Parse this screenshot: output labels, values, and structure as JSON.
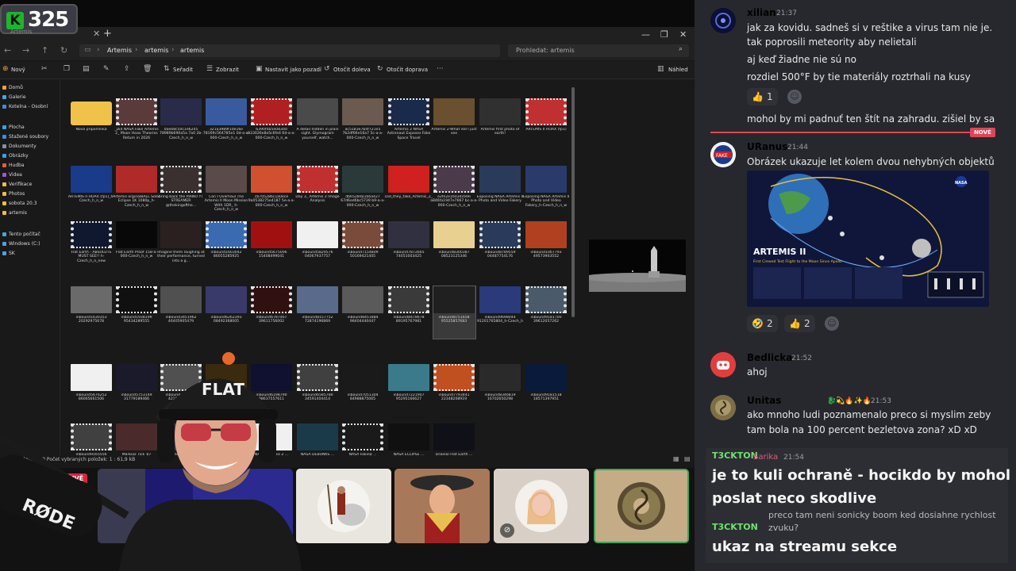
{
  "overlay_counter": {
    "k_label": "K",
    "value": "325"
  },
  "explorer": {
    "window_title": "Artemis",
    "breadcrumbs": [
      "Artemis",
      "artemis",
      "artemis"
    ],
    "search_placeholder": "Prohledat: artemis",
    "toolbar": {
      "new_label": "Nový",
      "sort_label": "Seřadit",
      "view_label": "Zobrazit",
      "set_bg_label": "Nastavit jako pozadí",
      "rotate_left_label": "Otočit doleva",
      "rotate_right_label": "Otočit doprava",
      "details_label": "Náhled"
    },
    "nav_items": [
      {
        "label": "Domů",
        "color": "#e8a33c"
      },
      {
        "label": "Galerie",
        "color": "#4aa3e0"
      },
      {
        "label": "Kotelna - Osobní",
        "color": "#3d8be0"
      },
      {
        "label": "Plocha",
        "color": "#3da0e0"
      },
      {
        "label": "Stažené soubory",
        "color": "#3d8be0"
      },
      {
        "label": "Dokumenty",
        "color": "#8a8fa0"
      },
      {
        "label": "Obrázky",
        "color": "#3da0e0"
      },
      {
        "label": "Hudba",
        "color": "#e0603d"
      },
      {
        "label": "Videa",
        "color": "#9b59d0"
      },
      {
        "label": "Verifikace",
        "color": "#e8c13c"
      },
      {
        "label": "Photos",
        "color": "#e8c13c"
      },
      {
        "label": "sobota 20.3",
        "color": "#e8c13c"
      },
      {
        "label": "artemis",
        "color": "#e8c13c"
      },
      {
        "label": "Tento počítač",
        "color": "#4aa3e0"
      },
      {
        "label": "Windows (C:)",
        "color": "#4aa3e0"
      },
      {
        "label": "SK",
        "color": "#4aa3e0"
      }
    ],
    "files": [
      {
        "name": "Nová připomínka",
        "color": "#f0c24a",
        "folder": true
      },
      {
        "name": "_Did NASA Fake Artemis 2_ Moon Hoax Theories Return in 2026",
        "color": "#5a3a3a"
      },
      {
        "name": "0ae68c50c1e6245 78989b690a5a 7a0 2b-Czech_h_n_w",
        "color": "#2a2a4a"
      },
      {
        "name": "321a3989f10e16e 78169c564785e1 0d-a-a-000-Czech_h_n_w",
        "color": "#3a5aa0"
      },
      {
        "name": "6390f4b5e083dd 833026e8a5c6fe4 6d-a-a-000-Czech_h_n_w",
        "color": "#b02020"
      },
      {
        "name": "A detail hidden in plain sight. Glymogram yourself, watch...",
        "color": "#4a4a4a"
      },
      {
        "name": "ac5183e7b4f721e5 7b2df66e16a7 5c-a-a-000-Czech_h_n_w",
        "color": "#6a5a50"
      },
      {
        "name": "Artemis 2 NASA Astronaut Exposes Fake Space Travel",
        "color": "#1a2a4a"
      },
      {
        "name": "Artemis 2-What did I just see",
        "color": "#6a5030"
      },
      {
        "name": "Artemis first photo of earth!",
        "color": "#303030"
      },
      {
        "name": "ARTEMIS II HOAX (fp1)",
        "color": "#c03030"
      },
      {
        "name": "ARTEMIS II HOAX (fp1)_h-Czech_h_n_w",
        "color": "#1a3a8a"
      },
      {
        "name": "Artemis orginalBALL Solar Eclipse 1K 1080p_h-Czech_h_n_w",
        "color": "#b02a2a"
      },
      {
        "name": "bring back the PIANO YT STREAMER @thekingofthe...",
        "color": "#3a3030"
      },
      {
        "name": "Can I Overhaul The Artemis II Moon Mission With 1DR_ h-Czech_h_n_w",
        "color": "#5a4a4a"
      },
      {
        "name": "cb705286c1a0ece 9a0538275e4187 5e-a-a-000-Czech_h_n_w",
        "color": "#d05030"
      },
      {
        "name": "Day 3_ Artemis 2 Image Analysis",
        "color": "#c03030"
      },
      {
        "name": "db6528da166a427 67d6ed6bc5739 b9-a-a-000-Czech_h_n_w",
        "color": "#2a3a3a"
      },
      {
        "name": "Did_they_fake_Artemis_2_",
        "color": "#d02020"
      },
      {
        "name": "e2fe2e16034c666 a846fa1947e7667 bc-a-a-000-Czech_h_n_w",
        "color": "#4a3a4a"
      },
      {
        "name": "Exposing NASA Artemis II Photo and Video Fakery",
        "color": "#2a3a5a"
      },
      {
        "name": "Exposing NASA Artemis II Photo and Video Fakery_h-Czech_h_n_w",
        "color": "#2a3a6a"
      },
      {
        "name": "Flat Earth - ABSOLUTE MUST SEE!! h-Czech_h_n_new",
        "color": "#101830"
      },
      {
        "name": "Flat Earth Proof 158-a-000-Czech_h_n_w",
        "color": "#080808"
      },
      {
        "name": "Imagine them laughing at their performance, turned into a g...",
        "color": "#2a2020"
      },
      {
        "name": "inbound1603042 86055285925",
        "color": "#3a6ab0"
      },
      {
        "name": "inbound5675006 15408499041",
        "color": "#a01010"
      },
      {
        "name": "inbound5829576 04067937757",
        "color": "#f0f0f0"
      },
      {
        "name": "inbound7154809 50169421405",
        "color": "#7a4a3a"
      },
      {
        "name": "inbound7872665 74051003425",
        "color": "#303040"
      },
      {
        "name": "inbound8300387 08523125346",
        "color": "#e8d090"
      },
      {
        "name": "inbound8789559 04487754176",
        "color": "#2a3a5a"
      },
      {
        "name": "inbound1067793 49573903552",
        "color": "#b04020"
      },
      {
        "name": "inbound1630353 20292975678",
        "color": "#6a6a6a"
      },
      {
        "name": "inbound1938199 95434289555",
        "color": "#101010"
      },
      {
        "name": "inbound3451962 46405905479",
        "color": "#505050"
      },
      {
        "name": "inbound6262393 08492368005",
        "color": "#3a3a6a"
      },
      {
        "name": "inbound6787467 39611756002",
        "color": "#301010"
      },
      {
        "name": "inbound8157752 72874196869",
        "color": "#5a6a8a"
      },
      {
        "name": "inbound8451884 98404440447",
        "color": "#5a5a5a"
      },
      {
        "name": "inbound8478678 89195767981",
        "color": "#3a3a3a"
      },
      {
        "name": "inbound8751658 95525857683",
        "color": "#202020"
      },
      {
        "name": "inbound9698044 91201765804_h-Czech_h",
        "color": "#2a3a7a"
      },
      {
        "name": "inbound9181700 39612057262",
        "color": "#4a5a6a"
      },
      {
        "name": "inbound5676252 86065661506",
        "color": "#f0f0f0"
      },
      {
        "name": "inbound5753149 31779189466",
        "color": "#1a1a2a"
      },
      {
        "name": "inbound2601302 42105543019",
        "color": "#505050"
      },
      {
        "name": "inbound5886519 62461876015",
        "color": "#3a2a10"
      },
      {
        "name": "inbound6198790 98637557611",
        "color": "#101030"
      },
      {
        "name": "inbound6585780 34591404414",
        "color": "#404040"
      },
      {
        "name": "inbound7051304 84988875065",
        "color": "#1a1a1a"
      },
      {
        "name": "inbound7221907 95295166627",
        "color": "#3a7a8a"
      },
      {
        "name": "inbound7793441 22348208919",
        "color": "#c05020"
      },
      {
        "name": "inbound8346819 16702650298",
        "color": "#2a2a2a"
      },
      {
        "name": "inbound9181518 18571397951",
        "color": "#0a1a3a"
      },
      {
        "name": "inbound9165556 77700000000",
        "color": "#404040"
      },
      {
        "name": "Markiaz_rick_b7",
        "color": "#4a2a2a"
      },
      {
        "name": "i_saved_the_world_h_live_after",
        "color": "#3a3a5a"
      },
      {
        "name": "Multi billion...",
        "color": "#3a3a4a"
      },
      {
        "name": "NASA Artemis 2 ...",
        "color": "#f0f0f0"
      },
      {
        "name": "NASA DEBUNKS ...",
        "color": "#1a3a4a"
      },
      {
        "name": "NASA Faking ...",
        "color": "#1a1a1a"
      },
      {
        "name": "NASA ECLIPSE ...",
        "color": "#101010"
      },
      {
        "name": "original Flat Earth ...",
        "color": "#101018"
      }
    ],
    "status": "Počet položek: 90   Počet vybraných položek: 1 : 61,9 kB"
  },
  "stream": {
    "live_label": "ŽIVĚ",
    "participants": [
      {
        "kind": "stream",
        "color": "#1a1a60"
      },
      {
        "kind": "avatar",
        "color": "#e9e6df"
      },
      {
        "kind": "avatar",
        "color": "#b07a60"
      },
      {
        "kind": "avatar",
        "color": "#f0c8b4"
      },
      {
        "kind": "avatar",
        "color": "#c8b088"
      }
    ],
    "mic_brand": "RØDE",
    "cap_text": "FLAT"
  },
  "chat": {
    "messages": [
      {
        "author": "xilian",
        "author_color": "#6ab0ff",
        "time": "21:37",
        "lines": [
          "jak za kovidu. sadneš si v reštike a virus tam nie je.",
          "tak poprosili meteority aby nelietali",
          "aj keď žiadne nie sú no",
          "rozdiel 500°F by tie materiály roztrhali  na kusy"
        ],
        "reactions": [
          {
            "emoji": "👍",
            "count": "1"
          }
        ],
        "extra_lines": [
          "mohol by mi padnuť ten štít na zahradu. zišiel by sa"
        ]
      },
      {
        "author": "URanus",
        "author_color": "#6ab0ff",
        "time": "21:44",
        "lines": [
          "Obrázek ukazuje let kolem dvou nehybných objektů"
        ],
        "image": {
          "title": "ARTEMIS II",
          "subtitle": "First Crewed Test Flight to the Moon Since Apollo",
          "agency_1": "NASA"
        },
        "reactions": [
          {
            "emoji": "🤣",
            "count": "2"
          },
          {
            "emoji": "👍",
            "count": "2"
          }
        ]
      },
      {
        "author": "Bedlicka",
        "author_color": "#6ab0ff",
        "time": "21:52",
        "lines": [
          "ahoj"
        ]
      },
      {
        "author": "Unitas",
        "author_color": "#e8c13c",
        "time": "21:53",
        "author_suffix": "🐉💫🔥✨🔥",
        "lines": [
          "ako mnoho ludi poznamenalo preco si myslim zeby",
          "tam bola na 100 percent bezletova zona? xD xD"
        ]
      }
    ],
    "new_badge": "NOVÉ",
    "faded_author": "Sarika",
    "faded_time": "21:54",
    "faded_line": "preco tam neni sonicky boom ked dosiahne rychlost",
    "faded_line_2": "zvuku?",
    "overlay": [
      {
        "name": "T3CKTON",
        "text_1": "je to kuli ochraně - hocikdo by mohol",
        "text_2": "poslat neco skodlive"
      },
      {
        "name": "T3CKTON",
        "text_1": "ukaz na streamu sekce"
      }
    ]
  }
}
